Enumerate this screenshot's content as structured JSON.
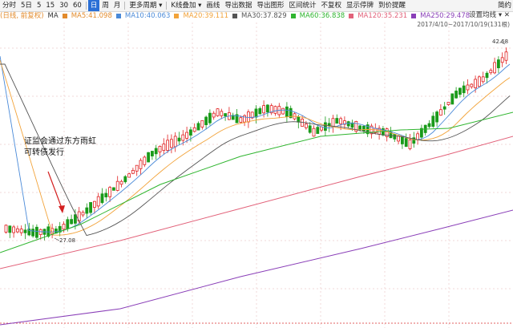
{
  "toolbar": {
    "items": [
      "分时",
      "5日",
      "5",
      "15",
      "30",
      "60",
      "日",
      "周",
      "月",
      "更多周期 ▾",
      "K线叠加 ▾",
      "画线",
      "导出数据",
      "导出图形",
      "区间统计",
      "不复权",
      "显示停牌",
      "到价提醒"
    ],
    "active": "日",
    "right_label": "简约"
  },
  "legend": {
    "mode": "(日线, 前复权)",
    "ma": [
      {
        "label": "MA",
        "color": "#333333"
      },
      {
        "label": "MA5:41.098",
        "color": "#e38b2c"
      },
      {
        "label": "MA10:40.063",
        "color": "#4a8ad8"
      },
      {
        "label": "MA20:39.111",
        "color": "#f2a33a"
      },
      {
        "label": "MA30:37.829",
        "color": "#555555"
      },
      {
        "label": "MA60:36.838",
        "color": "#2fb52f"
      },
      {
        "label": "MA120:35.231",
        "color": "#e2627a"
      },
      {
        "label": "MA250:29.478",
        "color": "#8a3fb8"
      }
    ]
  },
  "panel": {
    "settings": "设置均线",
    "range": "2017/4/10~2017/10/19(131根)"
  },
  "chart": {
    "high_label": "42.68",
    "low_label": "27.08",
    "annotation": [
      "证监会通过东方雨虹",
      "可转债发行"
    ]
  },
  "colors": {
    "up": "#e02020",
    "down": "#1a9a1a",
    "bg": "#ffffff"
  }
}
